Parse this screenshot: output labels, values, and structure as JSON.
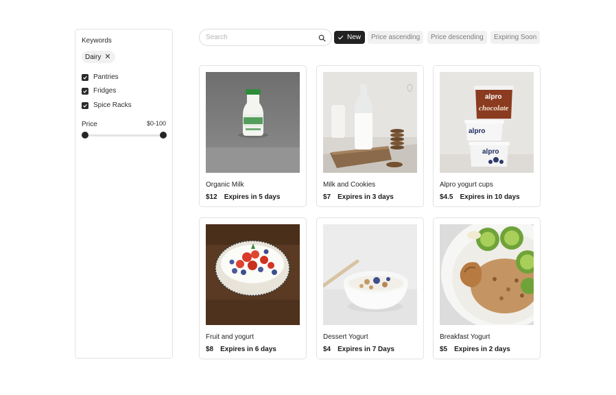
{
  "sidebar": {
    "keywords_title": "Keywords",
    "chip": {
      "label": "Dairy",
      "remove": "✕"
    },
    "checkboxes": [
      {
        "label": "Pantries",
        "checked": true
      },
      {
        "label": "Fridges",
        "checked": true
      },
      {
        "label": "Spice Racks",
        "checked": true
      }
    ],
    "price": {
      "label": "Price",
      "range": "$0-100",
      "min_fraction": 0,
      "max_fraction": 1
    }
  },
  "search": {
    "placeholder": "Search",
    "value": ""
  },
  "filters": [
    {
      "label": "New",
      "active": true
    },
    {
      "label": "Price ascending",
      "active": false
    },
    {
      "label": "Price descending",
      "active": false
    },
    {
      "label": "Expiring Soon",
      "active": false
    }
  ],
  "products": [
    {
      "name": "Organic Milk",
      "price": "$12",
      "expiry": "Expires in 5 days",
      "image": "milk-bottle"
    },
    {
      "name": "Milk and Cookies",
      "price": "$7",
      "expiry": "Expires in 3 days",
      "image": "milk-cookies"
    },
    {
      "name": "Alpro yogurt cups",
      "price": "$4.5",
      "expiry": "Expires in 10 days",
      "image": "alpro-cups",
      "brand_text": [
        "alpro",
        "chocolate",
        "alpro",
        "alpro"
      ]
    },
    {
      "name": "Fruit and yogurt",
      "price": "$8",
      "expiry": "Expires in 6 days",
      "image": "fruit-bowl"
    },
    {
      "name": "Dessert Yogurt",
      "price": "$4",
      "expiry": "Expires in 7 Days",
      "image": "dessert-bowl"
    },
    {
      "name": "Breakfast Yogurt",
      "price": "$5",
      "expiry": "Expires in 2 days",
      "image": "breakfast-bowl"
    }
  ],
  "colors": {
    "accent_dark": "#222222",
    "chip_bg": "#f1f1f1",
    "border": "#e2e2e2"
  }
}
